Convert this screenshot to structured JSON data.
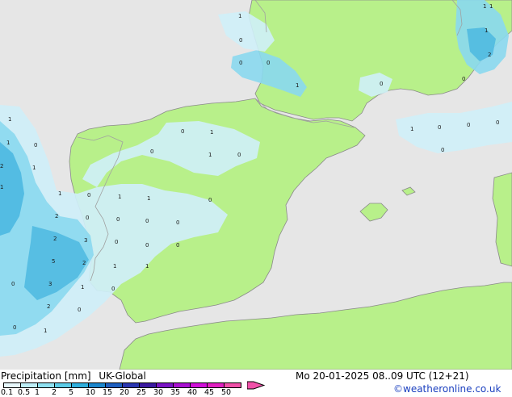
{
  "footer": {
    "label_precip": "Precipitation [mm]",
    "label_model": "UK-Global",
    "valid_time": "Mo 20-01-2025 08..09 UTC (12+21)",
    "credit": "©weatheronline.co.uk"
  },
  "legend": {
    "ticks": [
      "0.1",
      "0.5",
      "1",
      "2",
      "5",
      "10",
      "15",
      "20",
      "25",
      "30",
      "35",
      "40",
      "45",
      "50"
    ],
    "colors": [
      "#e6f7fb",
      "#bdeef7",
      "#8fe0f0",
      "#5ccbe6",
      "#30aedc",
      "#1c86cc",
      "#1e5fbf",
      "#2a36b0",
      "#3b1aa0",
      "#7a14c4",
      "#a810d0",
      "#d010d8",
      "#e020c0",
      "#f050a8"
    ]
  },
  "colors": {
    "sea": "#e6e6e6",
    "land": "#b8f08a",
    "coast": "#8a8a8a",
    "border": "#a0a0a0",
    "precip_light": "#cfeff8",
    "precip_mid": "#8ad8ee",
    "precip_heavy": "#48b6e0"
  },
  "map_values": [
    "1",
    "0",
    "0",
    "0",
    "1",
    "1",
    "0",
    "1",
    "0",
    "0",
    "0",
    "1",
    "0",
    "1",
    "0",
    "1",
    "1",
    "0",
    "1",
    "0",
    "1",
    "0",
    "1",
    "1",
    "0",
    "2",
    "0",
    "0",
    "1",
    "0",
    "2",
    "3",
    "2",
    "0",
    "0",
    "5",
    "2",
    "1",
    "1",
    "3",
    "1",
    "0",
    "2",
    "0",
    "0",
    "1",
    "1",
    "0",
    "2",
    "1",
    "0",
    "0",
    "0",
    "0"
  ]
}
